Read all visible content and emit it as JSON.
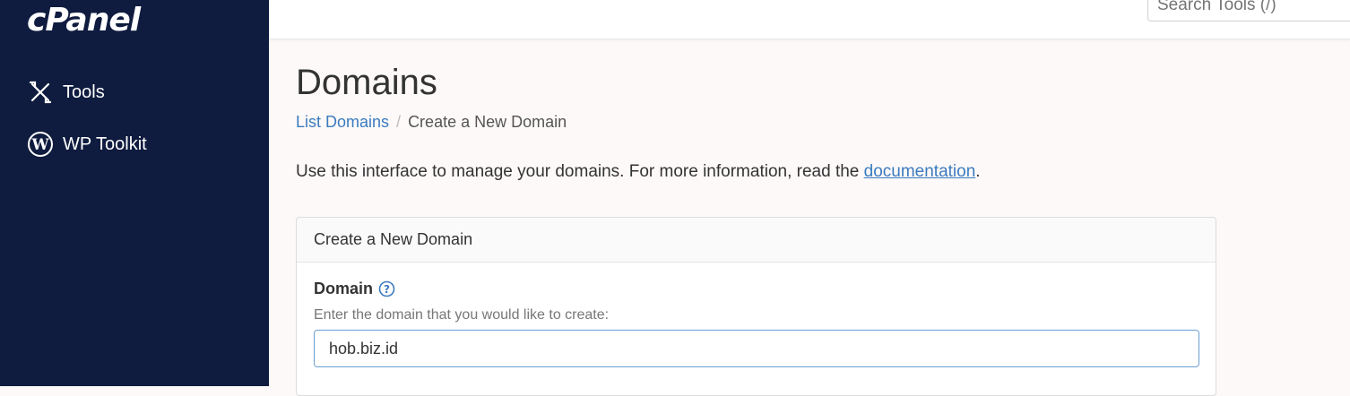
{
  "sidebar": {
    "logo": "cPanel",
    "items": [
      {
        "label": "Tools",
        "icon": "tools-icon"
      },
      {
        "label": "WP Toolkit",
        "icon": "wordpress-icon"
      }
    ]
  },
  "topbar": {
    "search_placeholder": "Search Tools (/)"
  },
  "page": {
    "title": "Domains",
    "breadcrumb": {
      "parent": "List Domains",
      "current": "Create a New Domain"
    },
    "intro_text": "Use this interface to manage your domains. For more information, read the ",
    "intro_link": "documentation",
    "intro_end": "."
  },
  "panel": {
    "title": "Create a New Domain",
    "field_label": "Domain",
    "field_help": "Enter the domain that you would like to create:",
    "field_value": "hob.biz.id"
  },
  "colors": {
    "sidebar_bg": "#0f1c3f",
    "link": "#3b7bbf",
    "input_border": "#6a9fd0"
  }
}
